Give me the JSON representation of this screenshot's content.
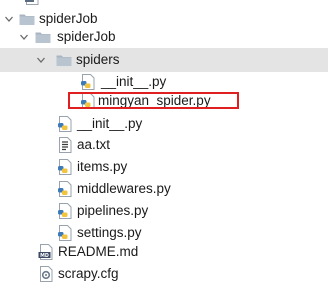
{
  "tree": {
    "items": [
      {
        "label": "",
        "icon": "log-file-icon",
        "expanded": false
      },
      {
        "label": "spiderJob",
        "icon": "folder-icon",
        "expanded": true
      },
      {
        "label": "spiderJob",
        "icon": "folder-icon",
        "expanded": true
      },
      {
        "label": "spiders",
        "icon": "folder-icon",
        "expanded": true,
        "selected": true
      },
      {
        "label": "__init__.py",
        "icon": "python-file-icon"
      },
      {
        "label": "mingyan_spider.py",
        "icon": "python-file-icon",
        "highlighted": true
      },
      {
        "label": "__init__.py",
        "icon": "python-file-icon"
      },
      {
        "label": "aa.txt",
        "icon": "text-file-icon"
      },
      {
        "label": "items.py",
        "icon": "python-file-icon"
      },
      {
        "label": "middlewares.py",
        "icon": "python-file-icon"
      },
      {
        "label": "pipelines.py",
        "icon": "python-file-icon"
      },
      {
        "label": "settings.py",
        "icon": "python-file-icon"
      },
      {
        "label": "README.md",
        "icon": "markdown-file-icon"
      },
      {
        "label": "scrapy.cfg",
        "icon": "config-file-icon"
      }
    ]
  },
  "colors": {
    "selection": "#e4e4e4",
    "highlight_border": "#e02020",
    "folder": "#a9b4c2",
    "python_blue": "#3d7ab8",
    "python_yellow": "#f2c43d"
  }
}
